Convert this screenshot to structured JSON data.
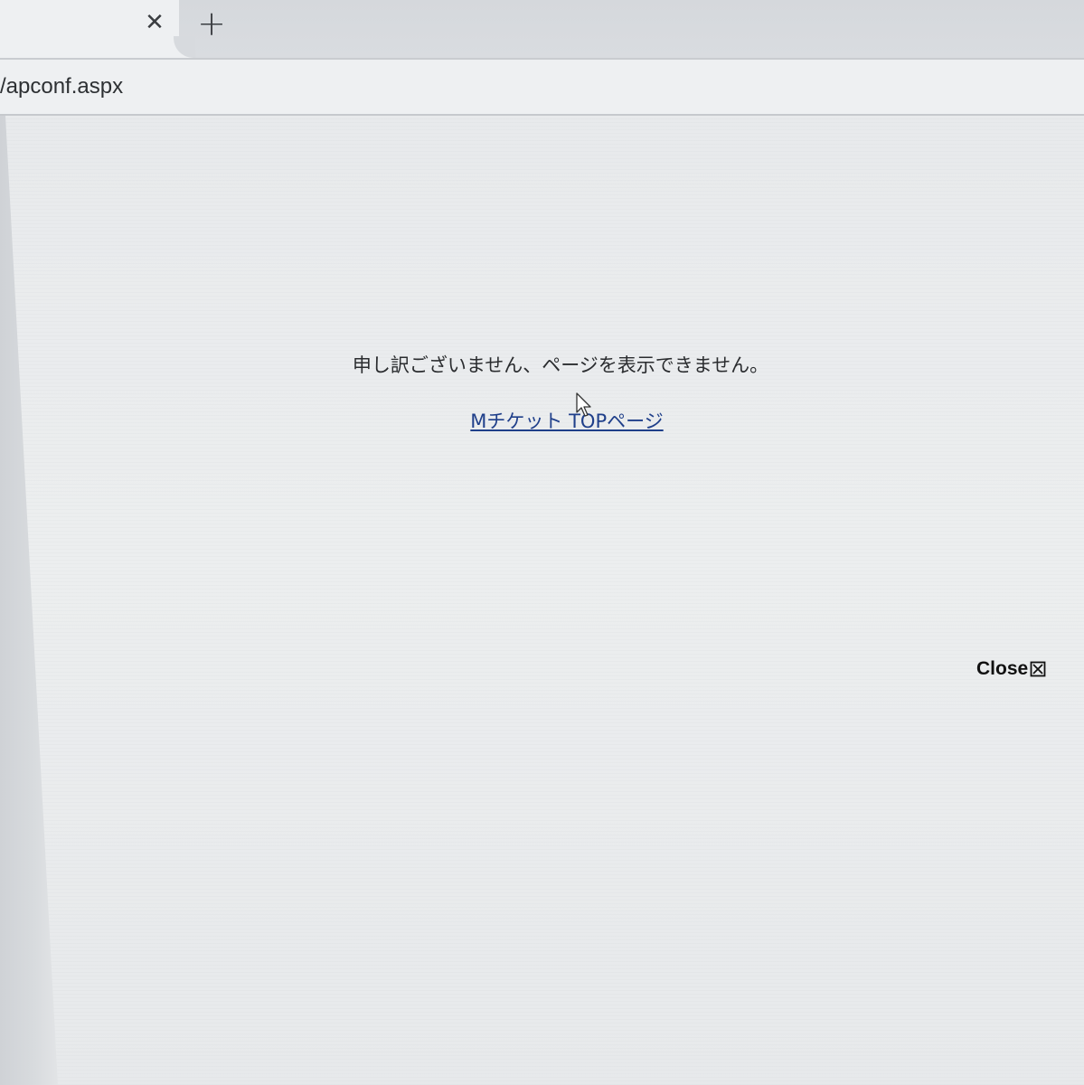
{
  "browser": {
    "tab": {
      "close_glyph": "✕"
    },
    "new_tab_glyph": "+",
    "address_bar": {
      "url_text": "/apconf.aspx"
    }
  },
  "page": {
    "message": "申し訳ございません、ページを表示できません。",
    "top_link_label": "Mチケット TOPページ",
    "close_label": "Close",
    "close_icon": "close-box-icon",
    "link_color": "#1f3f8a"
  }
}
